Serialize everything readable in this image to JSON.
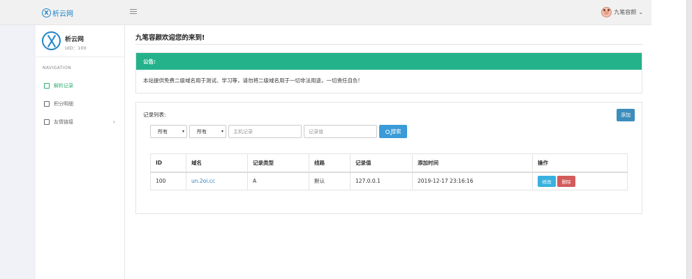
{
  "topbar": {
    "brand": "析云网",
    "user_name": "九笔容颜"
  },
  "sidebar": {
    "site_name": "析云网",
    "uid": "UID：100",
    "nav_heading": "NAVIGATION",
    "items": [
      {
        "label": "解析记录",
        "icon": "home-icon",
        "active": true
      },
      {
        "label": "积分明细",
        "icon": "points-icon",
        "active": false
      },
      {
        "label": "友情链接",
        "icon": "user-link-icon",
        "active": false
      }
    ]
  },
  "main": {
    "title": "九笔容颜欢迎您的来到!",
    "notice_title": "公告:",
    "notice_text": "本站提供免费二级域名用于测试、学习等，请勿将二级域名用于一切非法用途，一切责任自负!",
    "records_label": "记录列表:",
    "add_label": "添加",
    "filter_select_1": "所有",
    "filter_select_2": "所有",
    "host_placeholder": "主机记录",
    "value_placeholder": "记录值",
    "search_label": "搜索",
    "table": {
      "headers": [
        "ID",
        "域名",
        "记录类型",
        "线路",
        "记录值",
        "添加时间",
        "操作"
      ],
      "rows": [
        {
          "id": "100",
          "domain": "un.2oi.cc",
          "type": "A",
          "line": "默认",
          "value": "127.0.0.1",
          "time": "2019-12-17 23:16:16",
          "edit": "修改",
          "delete": "删除"
        }
      ]
    }
  },
  "colors": {
    "accent": "#24b28b",
    "primary": "#3c8dbc",
    "danger": "#d25b5b",
    "link": "#2e7bbf"
  }
}
